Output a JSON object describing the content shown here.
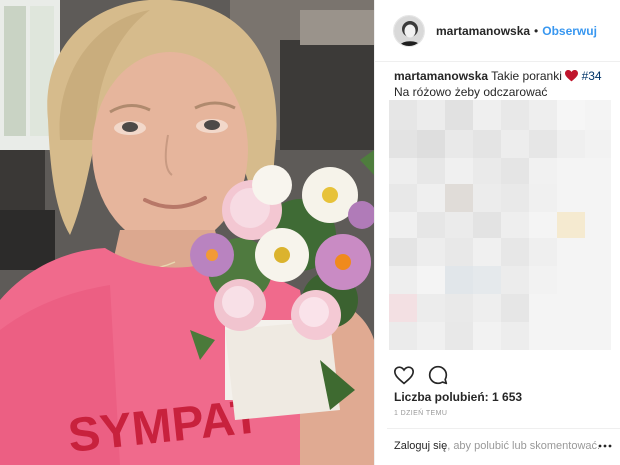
{
  "header": {
    "username": "martamanowska",
    "separator": "•",
    "follow_label": "Obserwuj"
  },
  "caption": {
    "username": "martamanowska",
    "text_before": "Takie poranki",
    "icon": "red-heart-icon",
    "hashtag": "#34",
    "text_after": "Na różowo żeby odczarować"
  },
  "actions": {
    "like_icon": "heart-outline-icon",
    "comment_icon": "speech-bubble-icon"
  },
  "likes": {
    "label": "Liczba polubień:",
    "count": "1 653"
  },
  "timestamp": "1 DZIEŃ TEMU",
  "login": {
    "link_label": "Zaloguj się",
    "rest": ", aby polubić lub skomentować."
  },
  "more_icon": "ellipsis-icon",
  "colors": {
    "accent": "#3897f0",
    "hashtag": "#003569",
    "heart": "#ed4956",
    "muted": "#999999"
  }
}
